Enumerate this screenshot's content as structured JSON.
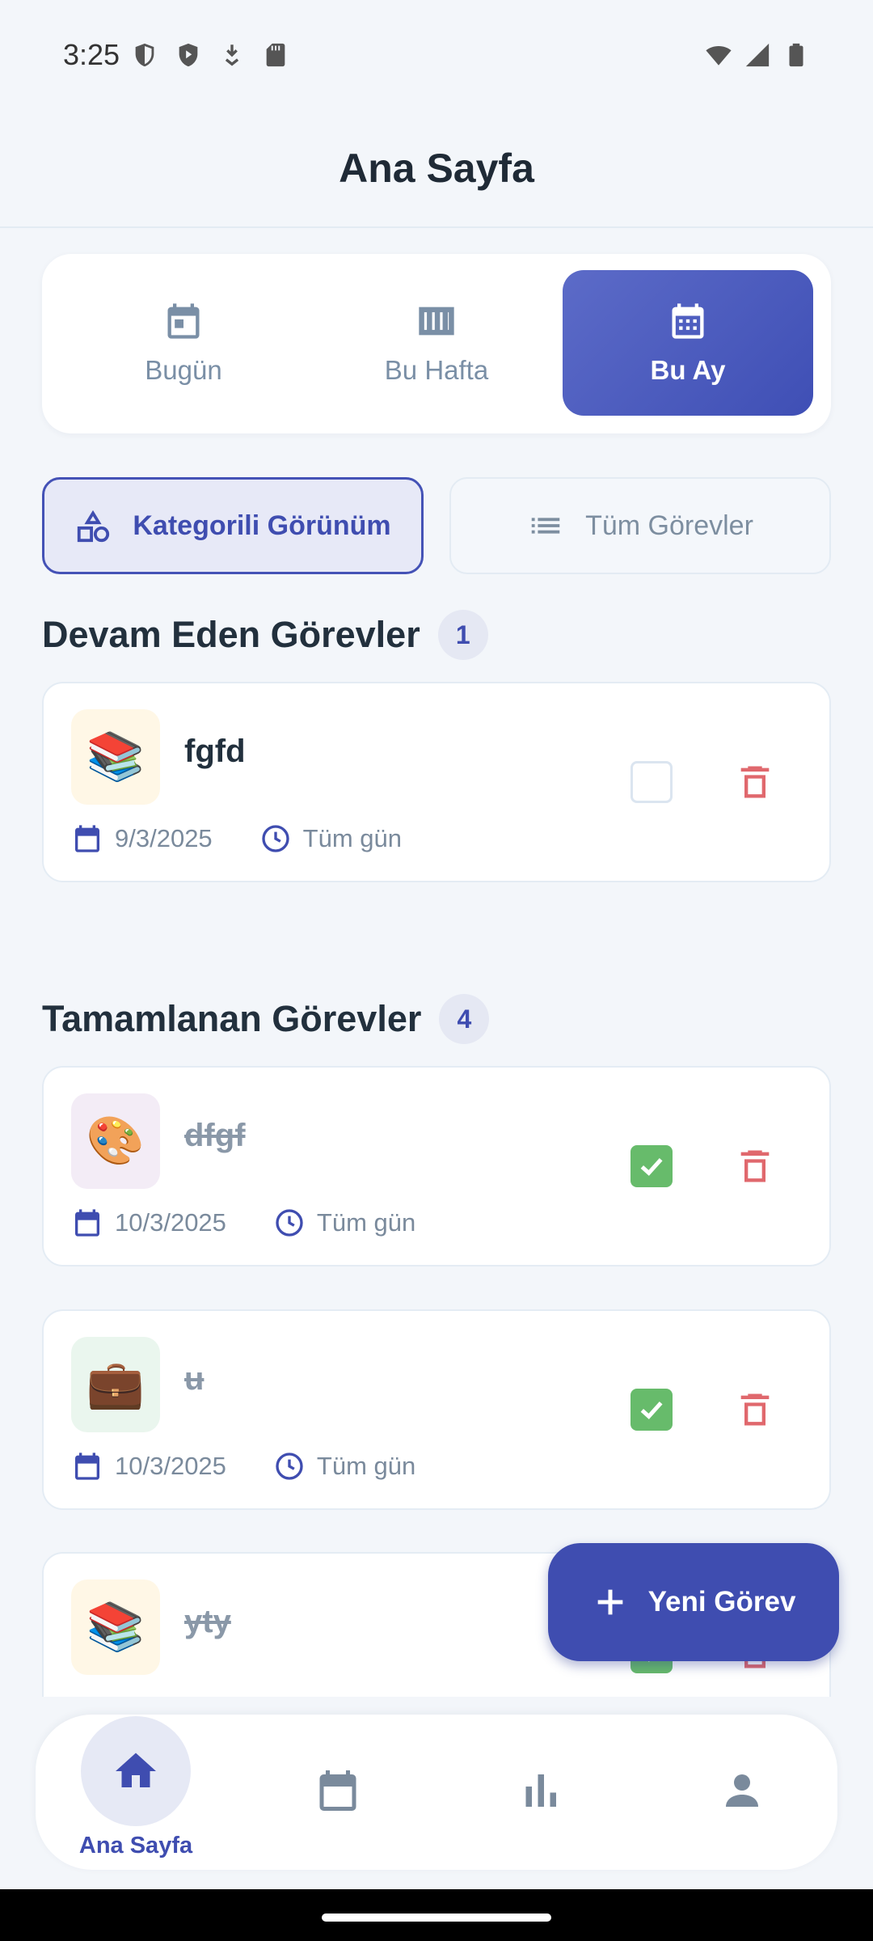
{
  "status_bar": {
    "time": "3:25",
    "left_icons": [
      "shield-outline-icon",
      "shield-play-icon",
      "download-icon",
      "sd-card-icon"
    ],
    "right_icons": [
      "wifi-icon",
      "signal-icon",
      "battery-icon"
    ]
  },
  "header": {
    "title": "Ana Sayfa"
  },
  "period_tabs": [
    {
      "label": "Bugün",
      "icon": "calendar-day-icon",
      "active": false
    },
    {
      "label": "Bu Hafta",
      "icon": "week-columns-icon",
      "active": false
    },
    {
      "label": "Bu Ay",
      "icon": "calendar-month-icon",
      "active": true
    }
  ],
  "view_toggle": {
    "categorized": "Kategorili Görünüm",
    "all_tasks": "Tüm Görevler",
    "active": "categorized"
  },
  "sections": {
    "in_progress": {
      "title": "Devam Eden Görevler",
      "count": "1",
      "tasks": [
        {
          "emoji": "📚",
          "name": "fgfd",
          "date": "9/3/2025",
          "time": "Tüm gün",
          "done": false,
          "emoji_bg": "#fff7e6"
        }
      ]
    },
    "completed": {
      "title": "Tamamlanan Görevler",
      "count": "4",
      "tasks": [
        {
          "emoji": "🎨",
          "name": "dfgf",
          "date": "10/3/2025",
          "time": "Tüm gün",
          "done": true,
          "emoji_bg": "#f3ecf6"
        },
        {
          "emoji": "💼",
          "name": "u",
          "date": "10/3/2025",
          "time": "Tüm gün",
          "done": true,
          "emoji_bg": "#eaf6ee"
        },
        {
          "emoji": "📚",
          "name": "yty",
          "date": "",
          "time": "",
          "done": true,
          "emoji_bg": "#fff7e6"
        }
      ]
    }
  },
  "fab": {
    "label": "Yeni Görev",
    "icon": "plus-icon"
  },
  "bottom_nav": [
    {
      "label": "Ana Sayfa",
      "icon": "home-icon",
      "active": true
    },
    {
      "label": "",
      "icon": "calendar-icon",
      "active": false
    },
    {
      "label": "",
      "icon": "bar-chart-icon",
      "active": false
    },
    {
      "label": "",
      "icon": "person-icon",
      "active": false
    }
  ],
  "colors": {
    "primary": "#3f4db0",
    "check_green": "#67bb6b",
    "delete_red": "#e0686d",
    "muted_text": "#7a8a9c"
  }
}
